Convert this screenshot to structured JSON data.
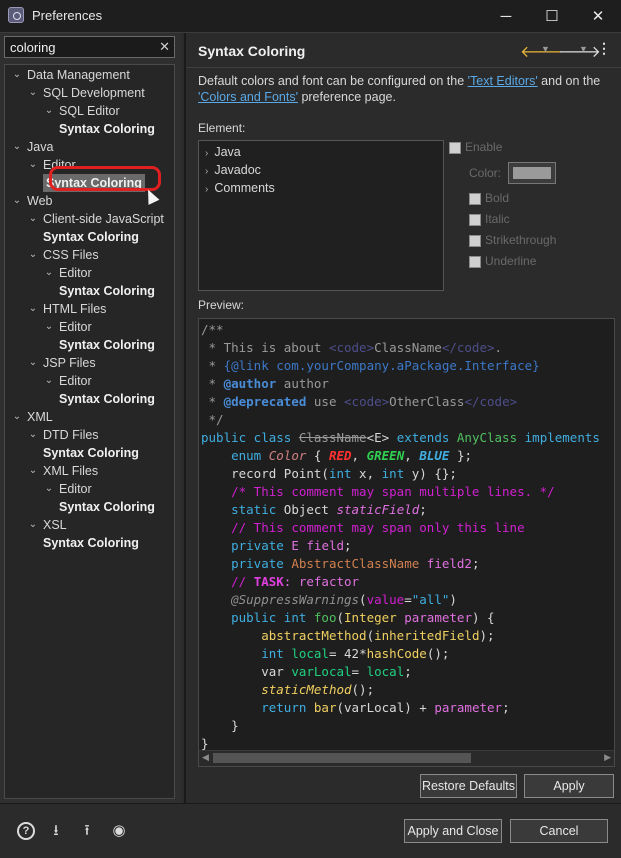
{
  "window": {
    "title": "Preferences",
    "minimize": "─",
    "maximize": "☐",
    "close": "✕"
  },
  "filter": {
    "value": "coloring",
    "placeholder": "",
    "clear_icon": "✕"
  },
  "tree": [
    {
      "label": "Data Management",
      "kind": "branch"
    },
    {
      "label": "SQL Development",
      "kind": "branch"
    },
    {
      "label": "SQL Editor",
      "kind": "branch"
    },
    {
      "label": "Syntax Coloring",
      "kind": "leaf"
    },
    {
      "label": "Java",
      "kind": "branch"
    },
    {
      "label": "Editor",
      "kind": "branch"
    },
    {
      "label": "Syntax Coloring",
      "kind": "leaf",
      "selected": true
    },
    {
      "label": "Web",
      "kind": "branch"
    },
    {
      "label": "Client-side JavaScript",
      "kind": "branch"
    },
    {
      "label": "Syntax Coloring",
      "kind": "leaf"
    },
    {
      "label": "CSS Files",
      "kind": "branch"
    },
    {
      "label": "Editor",
      "kind": "branch"
    },
    {
      "label": "Syntax Coloring",
      "kind": "leaf"
    },
    {
      "label": "HTML Files",
      "kind": "branch"
    },
    {
      "label": "Editor",
      "kind": "branch"
    },
    {
      "label": "Syntax Coloring",
      "kind": "leaf"
    },
    {
      "label": "JSP Files",
      "kind": "branch"
    },
    {
      "label": "Editor",
      "kind": "branch"
    },
    {
      "label": "Syntax Coloring",
      "kind": "leaf"
    },
    {
      "label": "XML",
      "kind": "branch"
    },
    {
      "label": "DTD Files",
      "kind": "branch"
    },
    {
      "label": "Syntax Coloring",
      "kind": "leaf"
    },
    {
      "label": "XML Files",
      "kind": "branch"
    },
    {
      "label": "Editor",
      "kind": "branch"
    },
    {
      "label": "Syntax Coloring",
      "kind": "leaf"
    },
    {
      "label": "XSL",
      "kind": "branch"
    },
    {
      "label": "Syntax Coloring",
      "kind": "leaf"
    }
  ],
  "page": {
    "title": "Syntax Coloring",
    "desc_pre": "Default colors and font can be configured on the ",
    "link1": "'Text Editors'",
    "desc_mid": " and on the ",
    "link2": "'Colors and Fonts'",
    "desc_post": " preference page.",
    "element_label": "Element:",
    "elements": [
      "Java",
      "Javadoc",
      "Comments"
    ],
    "enable_label": "Enable",
    "color_label": "Color:",
    "bold_label": "Bold",
    "italic_label": "Italic",
    "strike_label": "Strikethrough",
    "underline_label": "Underline",
    "preview_label": "Preview:",
    "restore_label": "Restore Defaults",
    "apply_label": "Apply"
  },
  "bottom": {
    "apply_close_label": "Apply and Close",
    "cancel_label": "Cancel",
    "icons": [
      "help-icon",
      "import-icon",
      "export-icon",
      "record-icon"
    ]
  },
  "colors": {
    "comment": "#888888",
    "keyword": "#3faee0",
    "tag": "#4a4a9c",
    "annotation": "#2a7ab5",
    "enum_const": "#00dd55",
    "blue_block_comment": "#cc00cc",
    "task_comment": "#e040e0",
    "field": "#e070e0",
    "method": "#f0d060",
    "type": "#50c060",
    "local": "#20d080"
  },
  "code": [
    [
      {
        "t": "/**",
        "c": "#9a9a9a"
      }
    ],
    [
      {
        "t": " * This is about ",
        "c": "#9a9a9a"
      },
      {
        "t": "<code>",
        "c": "#4e4e8c"
      },
      {
        "t": "ClassName",
        "c": "#9a9a9a"
      },
      {
        "t": "</code>",
        "c": "#4e4e8c"
      },
      {
        "t": ".",
        "c": "#9a9a9a"
      }
    ],
    [
      {
        "t": " * ",
        "c": "#9a9a9a"
      },
      {
        "t": "{@link com.yourCompany.aPackage.Interface}",
        "c": "#3c78c8"
      }
    ],
    [
      {
        "t": " * ",
        "c": "#9a9a9a"
      },
      {
        "t": "@author",
        "c": "#4a8cd8",
        "b": true
      },
      {
        "t": " author",
        "c": "#9a9a9a"
      }
    ],
    [
      {
        "t": " * ",
        "c": "#9a9a9a"
      },
      {
        "t": "@deprecated",
        "c": "#4a8cd8",
        "b": true
      },
      {
        "t": " use ",
        "c": "#9a9a9a"
      },
      {
        "t": "<code>",
        "c": "#4e4e8c"
      },
      {
        "t": "OtherClass",
        "c": "#9a9a9a"
      },
      {
        "t": "</code>",
        "c": "#4e4e8c"
      }
    ],
    [
      {
        "t": " */",
        "c": "#9a9a9a"
      }
    ],
    [
      {
        "t": "public class ",
        "c": "#3faee0"
      },
      {
        "t": "ClassName",
        "c": "#9a9a9a",
        "s": true
      },
      {
        "t": "<E> ",
        "c": "#d8d8d8"
      },
      {
        "t": "extends ",
        "c": "#3faee0"
      },
      {
        "t": "AnyClass ",
        "c": "#50c060"
      },
      {
        "t": "implements",
        "c": "#3faee0"
      }
    ],
    [
      {
        "t": "    "
      },
      {
        "t": "enum ",
        "c": "#3faee0"
      },
      {
        "t": "Color",
        "c": "#d08080",
        "i": true
      },
      {
        "t": " { ",
        "c": "#d8d8d8"
      },
      {
        "t": "RED",
        "c": "#ff3030",
        "b": true,
        "i": true
      },
      {
        "t": ", ",
        "c": "#d8d8d8"
      },
      {
        "t": "GREEN",
        "c": "#30d050",
        "b": true,
        "i": true
      },
      {
        "t": ", ",
        "c": "#d8d8d8"
      },
      {
        "t": "BLUE",
        "c": "#3faee0",
        "b": true,
        "i": true
      },
      {
        "t": " };",
        "c": "#d8d8d8"
      }
    ],
    [
      {
        "t": "    "
      },
      {
        "t": "record Point(",
        "c": "#d8d8d8"
      },
      {
        "t": "int",
        "c": "#3faee0"
      },
      {
        "t": " x, ",
        "c": "#d8d8d8"
      },
      {
        "t": "int",
        "c": "#3faee0"
      },
      {
        "t": " y) {};",
        "c": "#d8d8d8"
      }
    ],
    [
      {
        "t": "    "
      },
      {
        "t": "/* This comment may span multiple lines. */",
        "c": "#d020d0"
      }
    ],
    [
      {
        "t": "    "
      },
      {
        "t": "static ",
        "c": "#3faee0"
      },
      {
        "t": "Object ",
        "c": "#d8d8d8"
      },
      {
        "t": "staticField",
        "c": "#e070e0",
        "i": true
      },
      {
        "t": ";",
        "c": "#d8d8d8"
      }
    ],
    [
      {
        "t": "    "
      },
      {
        "t": "// This comment may span only this line",
        "c": "#d020d0"
      }
    ],
    [
      {
        "t": "    "
      },
      {
        "t": "private ",
        "c": "#3faee0"
      },
      {
        "t": "E ",
        "c": "#e070e0"
      },
      {
        "t": "field",
        "c": "#e070e0"
      },
      {
        "t": ";",
        "c": "#d8d8d8"
      }
    ],
    [
      {
        "t": "    "
      },
      {
        "t": "private ",
        "c": "#3faee0"
      },
      {
        "t": "AbstractClassName ",
        "c": "#d08050"
      },
      {
        "t": "field2",
        "c": "#e070e0"
      },
      {
        "t": ";",
        "c": "#d8d8d8"
      }
    ],
    [
      {
        "t": "    "
      },
      {
        "t": "// ",
        "c": "#d020d0"
      },
      {
        "t": "TASK",
        "c": "#e040e0",
        "b": true
      },
      {
        "t": ": refactor",
        "c": "#e070e0"
      }
    ],
    [
      {
        "t": "    "
      },
      {
        "t": "@SuppressWarnings",
        "c": "#909090",
        "i": true
      },
      {
        "t": "(",
        "c": "#d8d8d8"
      },
      {
        "t": "value",
        "c": "#d020d0"
      },
      {
        "t": "=",
        "c": "#d8d8d8"
      },
      {
        "t": "\"all\"",
        "c": "#3faee0"
      },
      {
        "t": ")",
        "c": "#d8d8d8"
      }
    ],
    [
      {
        "t": "    "
      },
      {
        "t": "public ",
        "c": "#3faee0"
      },
      {
        "t": "int ",
        "c": "#3faee0"
      },
      {
        "t": "foo",
        "c": "#50c060"
      },
      {
        "t": "(",
        "c": "#d8d8d8"
      },
      {
        "t": "Integer ",
        "c": "#f0d060"
      },
      {
        "t": "parameter",
        "c": "#e070e0"
      },
      {
        "t": ") {",
        "c": "#d8d8d8"
      }
    ],
    [
      {
        "t": "        "
      },
      {
        "t": "abstractMethod",
        "c": "#f0d060"
      },
      {
        "t": "(",
        "c": "#d8d8d8"
      },
      {
        "t": "inheritedField",
        "c": "#f0d060"
      },
      {
        "t": ");",
        "c": "#d8d8d8"
      }
    ],
    [
      {
        "t": "        "
      },
      {
        "t": "int ",
        "c": "#3faee0"
      },
      {
        "t": "local",
        "c": "#20d080"
      },
      {
        "t": "= 42*",
        "c": "#d8d8d8"
      },
      {
        "t": "hashCode",
        "c": "#f0d060"
      },
      {
        "t": "();",
        "c": "#d8d8d8"
      }
    ],
    [
      {
        "t": "        "
      },
      {
        "t": "var ",
        "c": "#d8d8d8"
      },
      {
        "t": "varLocal",
        "c": "#20d080"
      },
      {
        "t": "= ",
        "c": "#d8d8d8"
      },
      {
        "t": "local",
        "c": "#20d080"
      },
      {
        "t": ";",
        "c": "#d8d8d8"
      }
    ],
    [
      {
        "t": "        "
      },
      {
        "t": "staticMethod",
        "c": "#f0d060",
        "i": true
      },
      {
        "t": "();",
        "c": "#d8d8d8"
      }
    ],
    [
      {
        "t": "        "
      },
      {
        "t": "return ",
        "c": "#3faee0"
      },
      {
        "t": "bar",
        "c": "#f0d060"
      },
      {
        "t": "(varLocal) + ",
        "c": "#d8d8d8"
      },
      {
        "t": "parameter",
        "c": "#e070e0"
      },
      {
        "t": ";",
        "c": "#d8d8d8"
      }
    ],
    [
      {
        "t": "    }",
        "c": "#d8d8d8"
      }
    ],
    [
      {
        "t": "}",
        "c": "#d8d8d8"
      }
    ]
  ]
}
